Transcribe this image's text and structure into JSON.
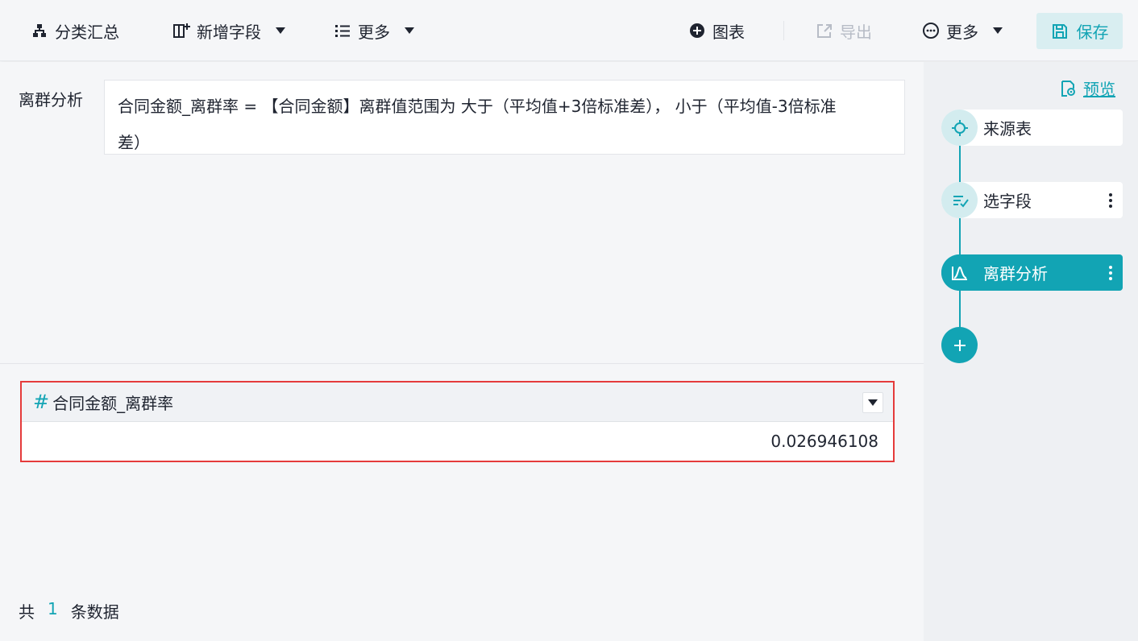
{
  "toolbar": {
    "group_summary": "分类汇总",
    "add_field": "新增字段",
    "more_left": "更多",
    "chart": "图表",
    "export": "导出",
    "more_right": "更多",
    "save": "保存"
  },
  "formula": {
    "label": "离群分析",
    "line1": "合同金额_离群率 = 【合同金额】离群值范围为 大于（平均值+3倍标准差）， 小于（平均值-3倍标准",
    "line2": "差）"
  },
  "result": {
    "column_name": "合同金额_离群率",
    "column_type_icon": "#",
    "value": "0.026946108"
  },
  "footer": {
    "prefix": "共",
    "count": "1",
    "suffix": "条数据"
  },
  "flow": {
    "preview": "预览",
    "nodes": [
      {
        "label": "来源表",
        "icon": "crosshair-icon"
      },
      {
        "label": "选字段",
        "icon": "select-fields-icon"
      },
      {
        "label": "离群分析",
        "icon": "outlier-curve-icon"
      }
    ]
  },
  "colors": {
    "accent": "#12a4b4",
    "highlight_border": "#e53b3b",
    "disabled_text": "#b7bcc6"
  }
}
